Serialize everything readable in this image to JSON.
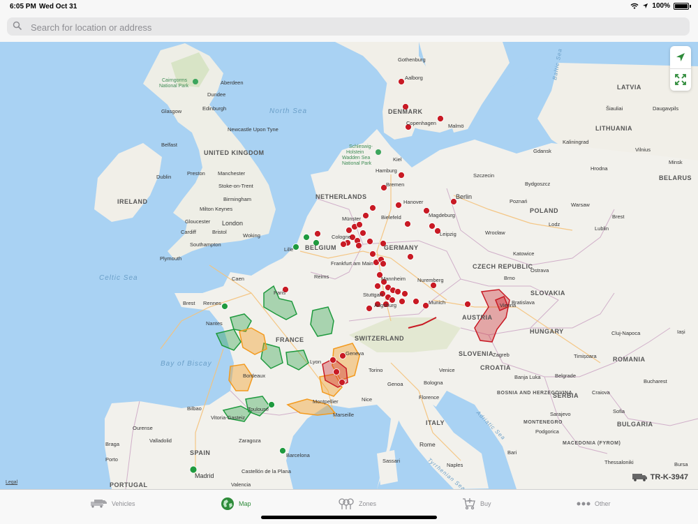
{
  "status": {
    "time": "6:05 PM",
    "date": "Wed Oct 31",
    "battery": "100%"
  },
  "search": {
    "placeholder": "Search for location or address"
  },
  "map": {
    "seas": [
      "North Sea",
      "Celtic Sea",
      "Bay of Biscay",
      "Baltic Sea",
      "Adriatic Sea",
      "Tyrrhenian Sea"
    ],
    "countries": [
      "UNITED KINGDOM",
      "IRELAND",
      "NETHERLANDS",
      "BELGIUM",
      "GERMANY",
      "DENMARK",
      "FRANCE",
      "SWITZERLAND",
      "AUSTRIA",
      "CZECH REPUBLIC",
      "POLAND",
      "SLOVAKIA",
      "HUNGARY",
      "ROMANIA",
      "SLOVENIA",
      "CROATIA",
      "BOSNIA AND HERZEGOVINA",
      "SERBIA",
      "MONTENEGRO",
      "BULGARIA",
      "MACEDONIA (FYROM)",
      "ITALY",
      "SPAIN",
      "PORTUGAL",
      "LATVIA",
      "LITHUANIA",
      "BELARUS"
    ],
    "cities": [
      "Gothenburg",
      "Aalborg",
      "Copenhagen",
      "Malmö",
      "Aberdeen",
      "Dundee",
      "Edinburgh",
      "Glasgow",
      "Newcastle Upon Tyne",
      "Belfast",
      "Dublin",
      "Preston",
      "Manchester",
      "Stoke-on-Trent",
      "Birmingham",
      "Milton Keynes",
      "Gloucester",
      "Cardiff",
      "Bristol",
      "London",
      "Woking",
      "Southampton",
      "Plymouth",
      "Hamburg",
      "Kiel",
      "Bremen",
      "Hanover",
      "Berlin",
      "Magdeburg",
      "Bielefeld",
      "Münster",
      "Cologne",
      "Leipzig",
      "Frankfurt am Main",
      "Mannheim",
      "Stuttgart",
      "Nuremberg",
      "Munich",
      "Augsburg",
      "Lille",
      "Caen",
      "Reims",
      "Paris",
      "Rennes",
      "Brest",
      "Nantes",
      "Bordeaux",
      "Lyon",
      "Geneva",
      "Torino",
      "Genoa",
      "Bologna",
      "Florence",
      "Venice",
      "Montpellier",
      "Marseille",
      "Nice",
      "Toulouse",
      "Bilbao",
      "Vitoria-Gasteiz",
      "Zaragoza",
      "Barcelona",
      "Ourense",
      "Braga",
      "Porto",
      "Valladolid",
      "Madrid",
      "Castellón de la Plana",
      "Valencia",
      "Rome",
      "Naples",
      "Bari",
      "Sassari",
      "Szczecin",
      "Gdansk",
      "Kaliningrad",
      "Bydgoszcz",
      "Poznań",
      "Warsaw",
      "Lodz",
      "Wrocław",
      "Katowice",
      "Ostrava",
      "Brno",
      "Bratislava",
      "Vienna",
      "Lublin",
      "Brest",
      "Hrodna",
      "Minsk",
      "Vilnius",
      "Šiauliai",
      "Daugavpils",
      "Zagreb",
      "Banja Luka",
      "Sarajevo",
      "Belgrade",
      "Timișoara",
      "Cluj-Napoca",
      "Iași",
      "Craiova",
      "Bucharest",
      "Podgorica",
      "Sofia",
      "Thessaloniki",
      "Bursa"
    ],
    "parks": [
      "Cairngorms National Park",
      "Schleswig-Holstein Wadden Sea National Park"
    ],
    "colors": {
      "red": "#c81a24",
      "green": "#1f9a3e",
      "orange": "#f39a1e",
      "water": "#a9d2f3",
      "land": "#f2f1ec"
    }
  },
  "controls": {
    "locate": "location-arrow-icon",
    "fullscreen": "expand-icon"
  },
  "legal": "Legal",
  "vehicle_plate": "TR-K-3947",
  "tabs": [
    {
      "label": "Vehicles",
      "icon": "trucks-icon",
      "active": false
    },
    {
      "label": "Map",
      "icon": "globe-icon",
      "active": true
    },
    {
      "label": "Zones",
      "icon": "zones-icon",
      "active": false
    },
    {
      "label": "Buy",
      "icon": "cart-icon",
      "active": false
    },
    {
      "label": "Other",
      "icon": "more-icon",
      "active": false
    }
  ]
}
